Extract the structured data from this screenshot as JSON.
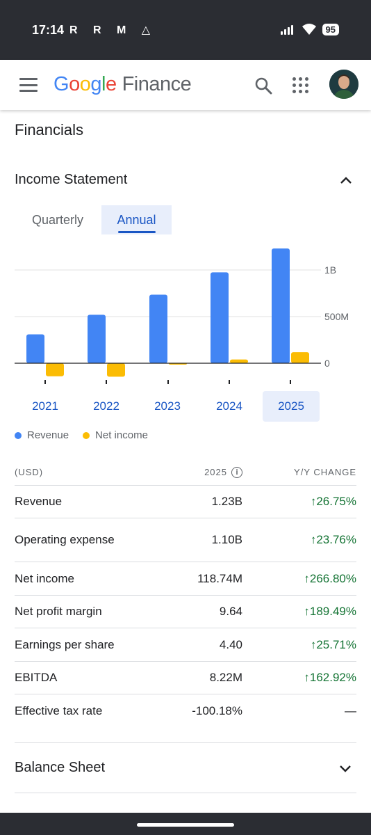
{
  "status_bar": {
    "time": "17:14",
    "notification_icons": "R R M △",
    "battery": "95",
    "icons": [
      "signal-icon",
      "wifi-icon",
      "battery-icon"
    ]
  },
  "header": {
    "logo_google": [
      "G",
      "o",
      "o",
      "g",
      "l",
      "e"
    ],
    "logo_finance": "Finance",
    "icons": [
      "menu-icon",
      "search-icon",
      "apps-icon",
      "avatar"
    ]
  },
  "page": {
    "title": "Financials"
  },
  "income_statement": {
    "title": "Income Statement",
    "tabs": [
      {
        "label": "Quarterly",
        "active": false
      },
      {
        "label": "Annual",
        "active": true
      }
    ],
    "years": [
      {
        "label": "2021",
        "active": false
      },
      {
        "label": "2022",
        "active": false
      },
      {
        "label": "2023",
        "active": false
      },
      {
        "label": "2024",
        "active": false
      },
      {
        "label": "2025",
        "active": true
      }
    ],
    "legend": [
      {
        "label": "Revenue",
        "color": "#4285f4"
      },
      {
        "label": "Net income",
        "color": "#fbbc04"
      }
    ],
    "table": {
      "headers": {
        "label": "(USD)",
        "year": "2025",
        "change": "Y/Y CHANGE"
      },
      "rows": [
        {
          "label": "Revenue",
          "value": "1.23B",
          "change": "↑26.75%"
        },
        {
          "label": "Operating expense",
          "value": "1.10B",
          "change": "↑23.76%"
        },
        {
          "label": "Net income",
          "value": "118.74M",
          "change": "↑266.80%"
        },
        {
          "label": "Net profit margin",
          "value": "9.64",
          "change": "↑189.49%"
        },
        {
          "label": "Earnings per share",
          "value": "4.40",
          "change": "↑25.71%"
        },
        {
          "label": "EBITDA",
          "value": "8.22M",
          "change": "↑162.92%"
        },
        {
          "label": "Effective tax rate",
          "value": "-100.18%",
          "change": "—"
        }
      ]
    }
  },
  "balance_sheet": {
    "title": "Balance Sheet"
  },
  "chart_data": {
    "type": "bar",
    "categories": [
      "2021",
      "2022",
      "2023",
      "2024",
      "2025"
    ],
    "series": [
      {
        "name": "Revenue",
        "color": "#4285f4",
        "values": [
          310000000,
          520000000,
          735000000,
          975000000,
          1230000000
        ]
      },
      {
        "name": "Net income",
        "color": "#fbbc04",
        "values": [
          -140000000,
          -145000000,
          -8000000,
          40000000,
          118740000
        ]
      }
    ],
    "y_ticks": [
      {
        "value": 1000000000,
        "label": "1B"
      },
      {
        "value": 500000000,
        "label": "500M"
      },
      {
        "value": 0,
        "label": "0"
      }
    ],
    "ylim": [
      -150000000,
      1230000000
    ],
    "grid": true
  }
}
